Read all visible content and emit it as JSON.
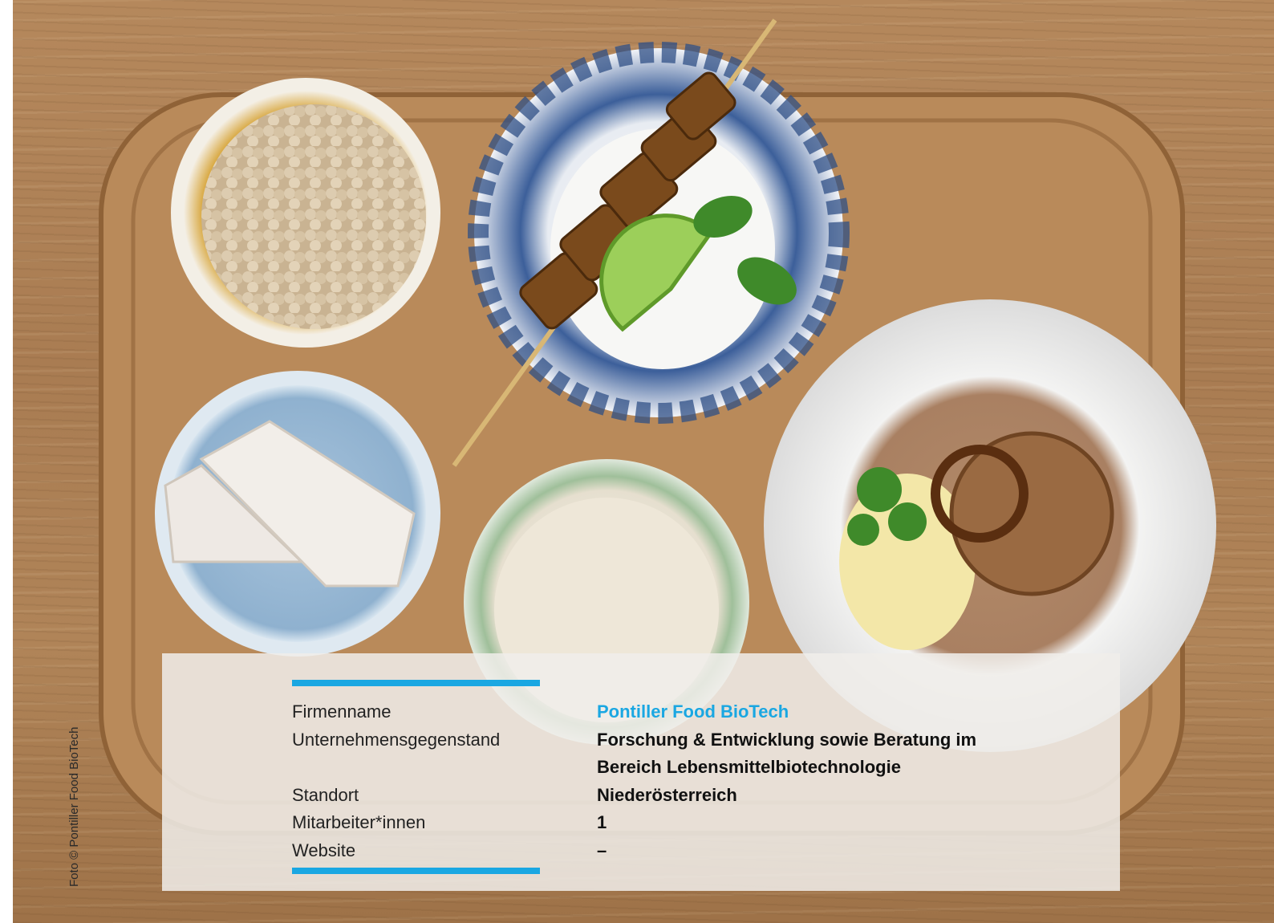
{
  "photo_credit": "Foto © Pontiller Food BioTech",
  "info": {
    "rows": [
      {
        "label": "Firmenname",
        "value": "Pontiller Food BioTech"
      },
      {
        "label": "Unternehmensgegenstand",
        "value_line1": "Forschung & Entwicklung sowie Beratung im",
        "value_line2": "Bereich Lebensmittelbiotechnologie"
      },
      {
        "label": "Standort",
        "value": "Niederösterreich"
      },
      {
        "label": "Mitarbeiter*innen",
        "value": "1"
      },
      {
        "label": "Website",
        "value": "–"
      }
    ]
  },
  "colors": {
    "accent": "#1aa7e2",
    "board": "#b98a5a",
    "wood": "#b08458"
  }
}
